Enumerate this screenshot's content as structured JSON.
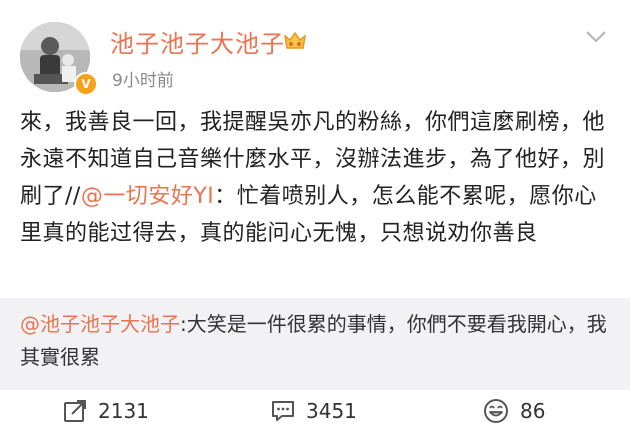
{
  "post": {
    "username": "池子池子大池子",
    "timestamp": "9小时前",
    "verified_badge": "V",
    "icons": {
      "avatar": "avatar-photo",
      "vip": "vip-crown-icon",
      "menu": "chevron-down-icon"
    },
    "text_part1": "來，我善良一回，我提醒吳亦凡的粉絲，你們這麼刷榜，他永遠不知道自己音樂什麼水平，沒辦法進步，為了他好，別刷了//",
    "mention": "@一切安好YI",
    "text_part2": "：忙着喷别人，怎么能不累呢，愿你心里真的能过得去，真的能问心无愧，只想说劝你善良"
  },
  "retweet": {
    "author_mention": "@池子池子大池子",
    "text": ":大笑是一件很累的事情，你們不要看我開心，我其實很累"
  },
  "footer": {
    "repost_count": "2131",
    "comment_count": "3451",
    "like_count": "86",
    "icons": {
      "repost": "share-icon",
      "comment": "comment-icon",
      "like": "smile-icon"
    }
  },
  "colors": {
    "accent": "#eb7350",
    "retweet_bg": "#f2f2f5",
    "text": "#222222",
    "meta": "#8a8a8a"
  }
}
